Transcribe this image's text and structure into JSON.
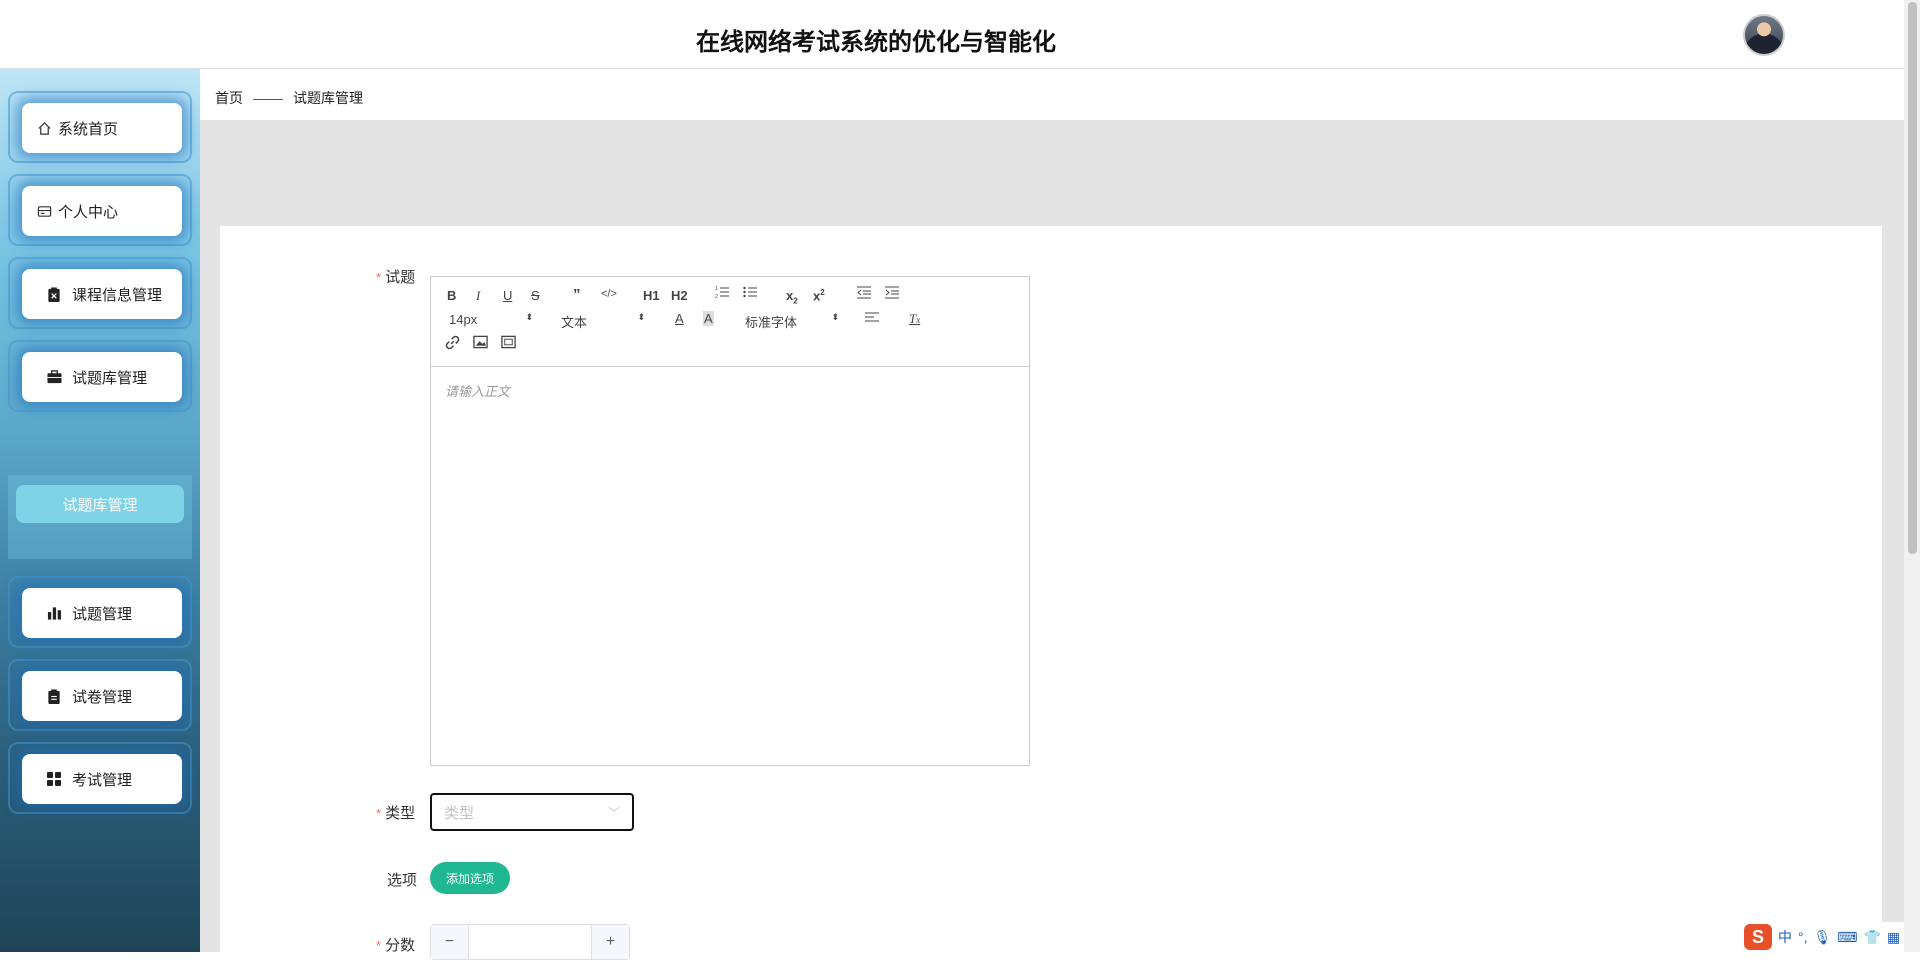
{
  "header": {
    "title": "在线网络考试系统的优化与智能化"
  },
  "sidebar": {
    "items": [
      {
        "label": "系统首页"
      },
      {
        "label": "个人中心"
      },
      {
        "label": "课程信息管理"
      },
      {
        "label": "试题库管理"
      },
      {
        "label": "试题管理"
      },
      {
        "label": "试卷管理"
      },
      {
        "label": "考试管理"
      }
    ],
    "submenu": {
      "label": "试题库管理"
    }
  },
  "breadcrumb": {
    "home": "首页",
    "current": "试题库管理"
  },
  "form": {
    "question_label": "试题",
    "editor": {
      "font_size": "14px",
      "header": "文本",
      "font_family": "标准字体",
      "placeholder": "请输入正文",
      "toolbar": {
        "h1": "H1",
        "h2": "H2"
      }
    },
    "type_label": "类型",
    "type_placeholder": "类型",
    "options_label": "选项",
    "add_option_button": "添加选项",
    "score_label": "分数",
    "score_minus": "−",
    "score_plus": "+"
  },
  "ime": {
    "logo": "S",
    "lang": "中"
  }
}
